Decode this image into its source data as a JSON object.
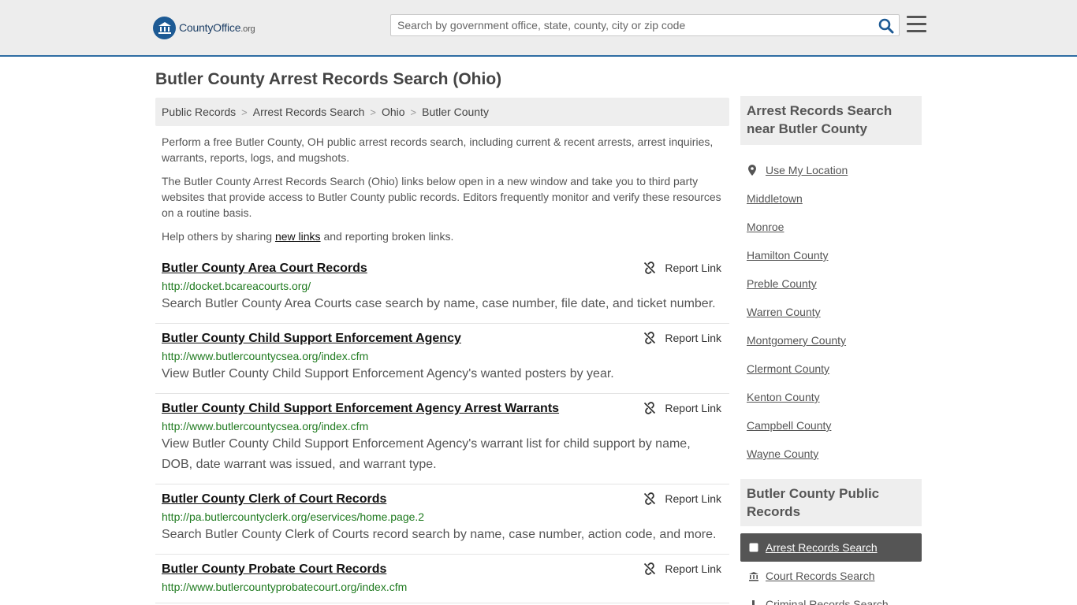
{
  "header": {
    "logo": {
      "brand": "County",
      "brand_bold": "Office",
      "tld": ".org"
    },
    "search_placeholder": "Search by government office, state, county, city or zip code"
  },
  "page_title": "Butler County Arrest Records Search (Ohio)",
  "breadcrumb": [
    "Public Records",
    "Arrest Records Search",
    "Ohio",
    "Butler County"
  ],
  "intro": {
    "p1": "Perform a free Butler County, OH public arrest records search, including current & recent arrests, arrest inquiries, warrants, reports, logs, and mugshots.",
    "p2": "The Butler County Arrest Records Search (Ohio) links below open in a new window and take you to third party websites that provide access to Butler County public records. Editors frequently monitor and verify these resources on a routine basis.",
    "p3_before": "Help others by sharing ",
    "p3_link": "new links",
    "p3_after": " and reporting broken links."
  },
  "report_label": "Report Link",
  "results": [
    {
      "title": "Butler County Area Court Records",
      "url": "http://docket.bcareacourts.org/",
      "desc": "Search Butler County Area Courts case search by name, case number, file date, and ticket number."
    },
    {
      "title": "Butler County Child Support Enforcement Agency",
      "url": "http://www.butlercountycsea.org/index.cfm",
      "desc": "View Butler County Child Support Enforcement Agency's wanted posters by year."
    },
    {
      "title": "Butler County Child Support Enforcement Agency Arrest Warrants",
      "url": "http://www.butlercountycsea.org/index.cfm",
      "desc": "View Butler County Child Support Enforcement Agency's warrant list for child support by name, DOB, date warrant was issued, and warrant type."
    },
    {
      "title": "Butler County Clerk of Court Records",
      "url": "http://pa.butlercountyclerk.org/eservices/home.page.2",
      "desc": "Search Butler County Clerk of Courts record search by name, case number, action code, and more."
    },
    {
      "title": "Butler County Probate Court Records",
      "url": "http://www.butlercountyprobatecourt.org/index.cfm",
      "desc": ""
    }
  ],
  "sidebar": {
    "near_title": "Arrest Records Search near Butler County",
    "use_location": "Use My Location",
    "near_items": [
      "Middletown",
      "Monroe",
      "Hamilton County",
      "Preble County",
      "Warren County",
      "Montgomery County",
      "Clermont County",
      "Kenton County",
      "Campbell County",
      "Wayne County"
    ],
    "pr_title": "Butler County Public Records",
    "pr_items": [
      {
        "label": "Arrest Records Search",
        "icon": "square-icon",
        "active": true
      },
      {
        "label": "Court Records Search",
        "icon": "courthouse-icon",
        "active": false
      },
      {
        "label": "Criminal Records Search",
        "icon": "gavel-icon",
        "active": false
      }
    ]
  },
  "colors": {
    "accent": "#2f6da3",
    "url_green": "#1f7a1f",
    "active_bg": "#555555"
  }
}
